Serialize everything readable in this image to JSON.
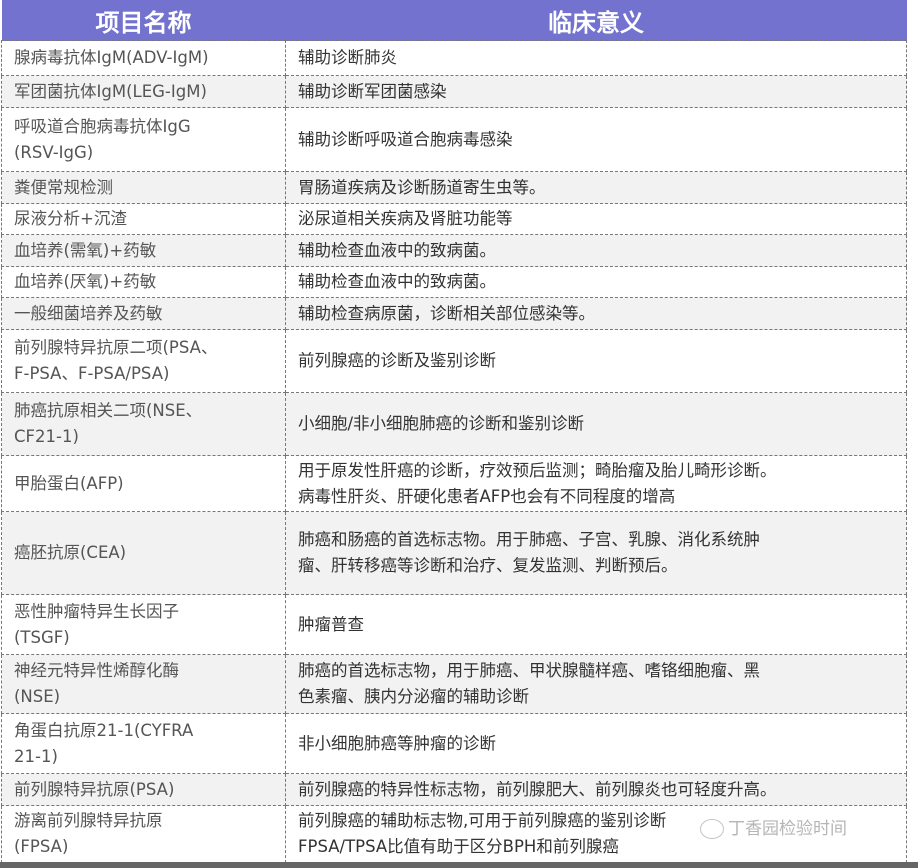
{
  "header": {
    "col1": "项目名称",
    "col2": "临床意义"
  },
  "rows": [
    {
      "name": "腺病毒抗体IgM(ADV-IgM)",
      "meaning": "辅助诊断肺炎"
    },
    {
      "name": "军团菌抗体IgM(LEG-IgM)",
      "meaning": "辅助诊断军团菌感染"
    },
    {
      "name": "呼吸道合胞病毒抗体IgG\n(RSV-IgG)",
      "meaning": "辅助诊断呼吸道合胞病毒感染"
    },
    {
      "name": "粪便常规检测",
      "meaning": "胃肠道疾病及诊断肠道寄生虫等。"
    },
    {
      "name": "尿液分析+沉渣",
      "meaning": "泌尿道相关疾病及肾脏功能等"
    },
    {
      "name": "血培养(需氧)+药敏",
      "meaning": "辅助检查血液中的致病菌。"
    },
    {
      "name": "血培养(厌氧)+药敏",
      "meaning": "辅助检查血液中的致病菌。"
    },
    {
      "name": "一般细菌培养及药敏",
      "meaning": "辅助检查病原菌，诊断相关部位感染等。"
    },
    {
      "name": "前列腺特异抗原二项(PSA、\nF-PSA、F-PSA/PSA)",
      "meaning": "前列腺癌的诊断及鉴别诊断"
    },
    {
      "name": "肺癌抗原相关二项(NSE、\nCF21-1)",
      "meaning": "小细胞/非小细胞肺癌的诊断和鉴别诊断"
    },
    {
      "name": "甲胎蛋白(AFP)",
      "meaning": "用于原发性肝癌的诊断，疗效预后监测；畸胎瘤及胎儿畸形诊断。\n病毒性肝炎、肝硬化患者AFP也会有不同程度的增高"
    },
    {
      "name": "癌胚抗原(CEA)",
      "meaning": "肺癌和肠癌的首选标志物。用于肺癌、子宫、乳腺、消化系统肿\n瘤、肝转移癌等诊断和治疗、复发监测、判断预后。"
    },
    {
      "name": "恶性肿瘤特异生长因子\n(TSGF)",
      "meaning": "肿瘤普查"
    },
    {
      "name": "神经元特异性烯醇化酶\n(NSE)",
      "meaning": "肺癌的首选标志物，用于肺癌、甲状腺髓样癌、嗜铬细胞瘤、黑\n色素瘤、胰内分泌瘤的辅助诊断"
    },
    {
      "name": "角蛋白抗原21-1(CYFRA\n21-1)",
      "meaning": "非小细胞肺癌等肿瘤的诊断"
    },
    {
      "name": "前列腺特异抗原(PSA)",
      "meaning": "前列腺癌的特异性标志物，前列腺肥大、前列腺炎也可轻度升高。"
    },
    {
      "name": "游离前列腺特异抗原\n(FPSA)",
      "meaning": "前列腺癌的辅助标志物,可用于前列腺癌的鉴别诊断\nFPSA/TPSA比值有助于区分BPH和前列腺癌"
    }
  ],
  "watermark": "丁香园检验时间"
}
